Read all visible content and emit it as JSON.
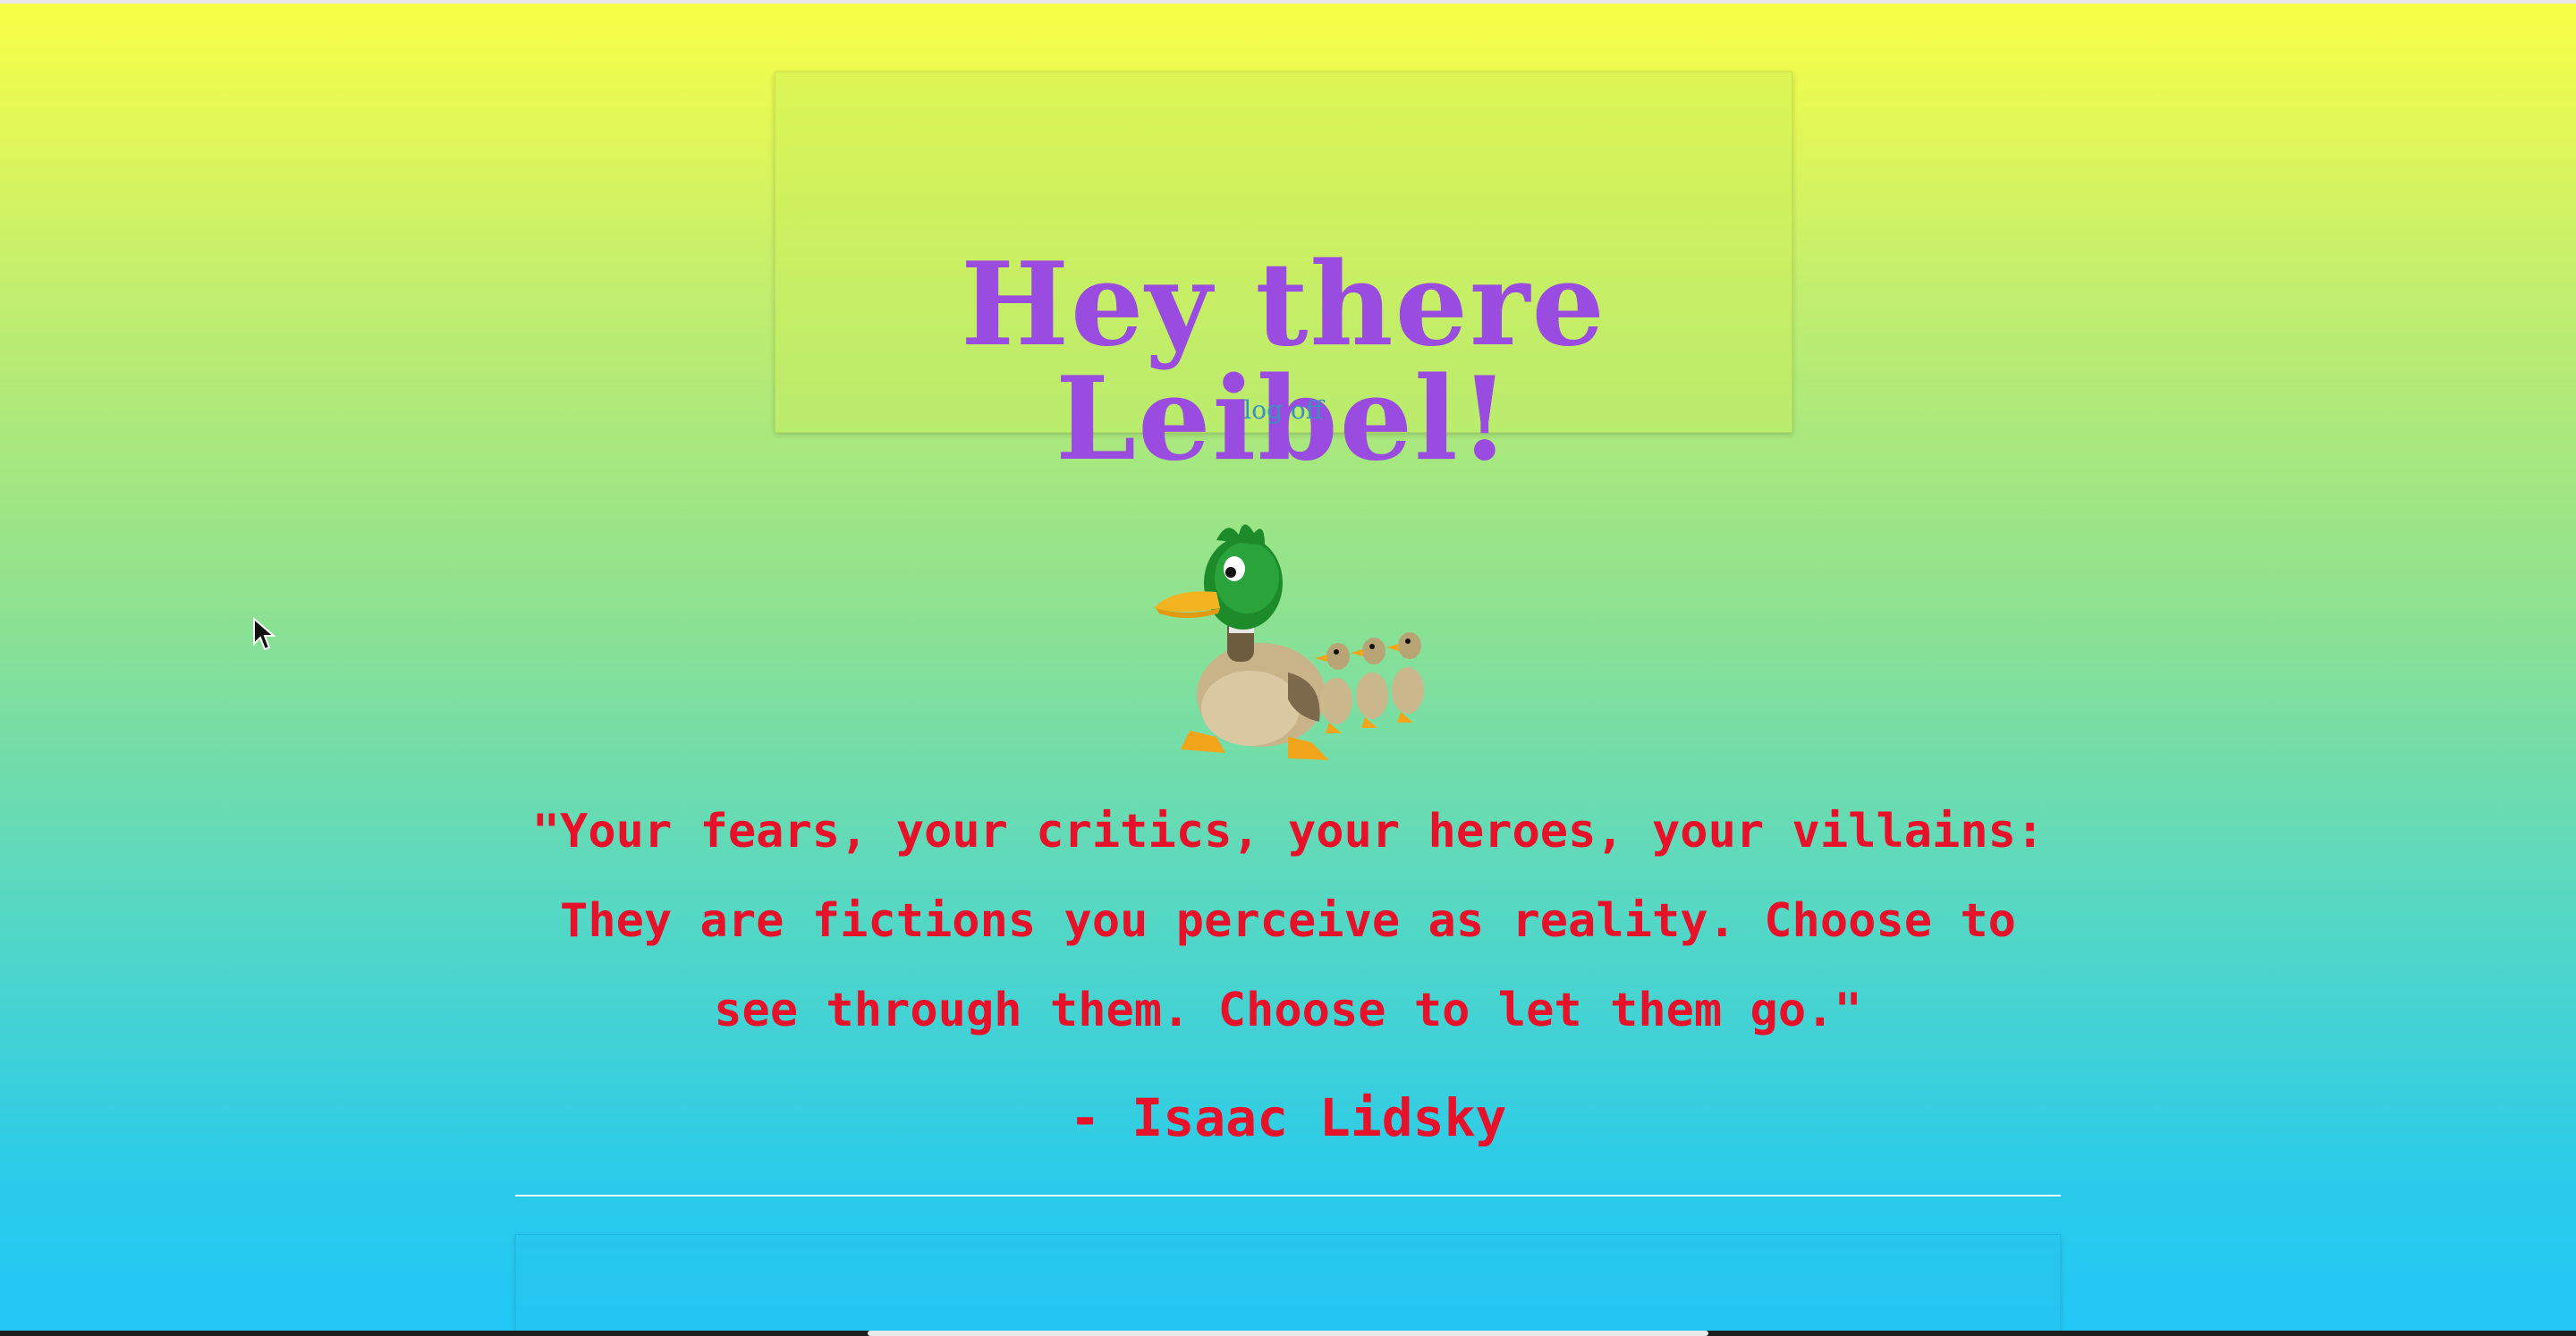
{
  "header": {
    "greeting": "Hey there Leibel!",
    "logoff_label": "log off"
  },
  "image": {
    "icon": "duck-family-icon",
    "description_visible": false
  },
  "quote": {
    "text": "\"Your fears, your critics, your heroes, your villains: They are fictions you perceive as reality. Choose to see through them. Choose to let them go.\"",
    "author": "- Isaac Lidsky"
  },
  "colors": {
    "gradient_top": "#faff45",
    "gradient_bottom": "#22c7f7",
    "greeting": "#9a4be0",
    "link": "#3c8fbe",
    "quote": "#e8112a"
  }
}
